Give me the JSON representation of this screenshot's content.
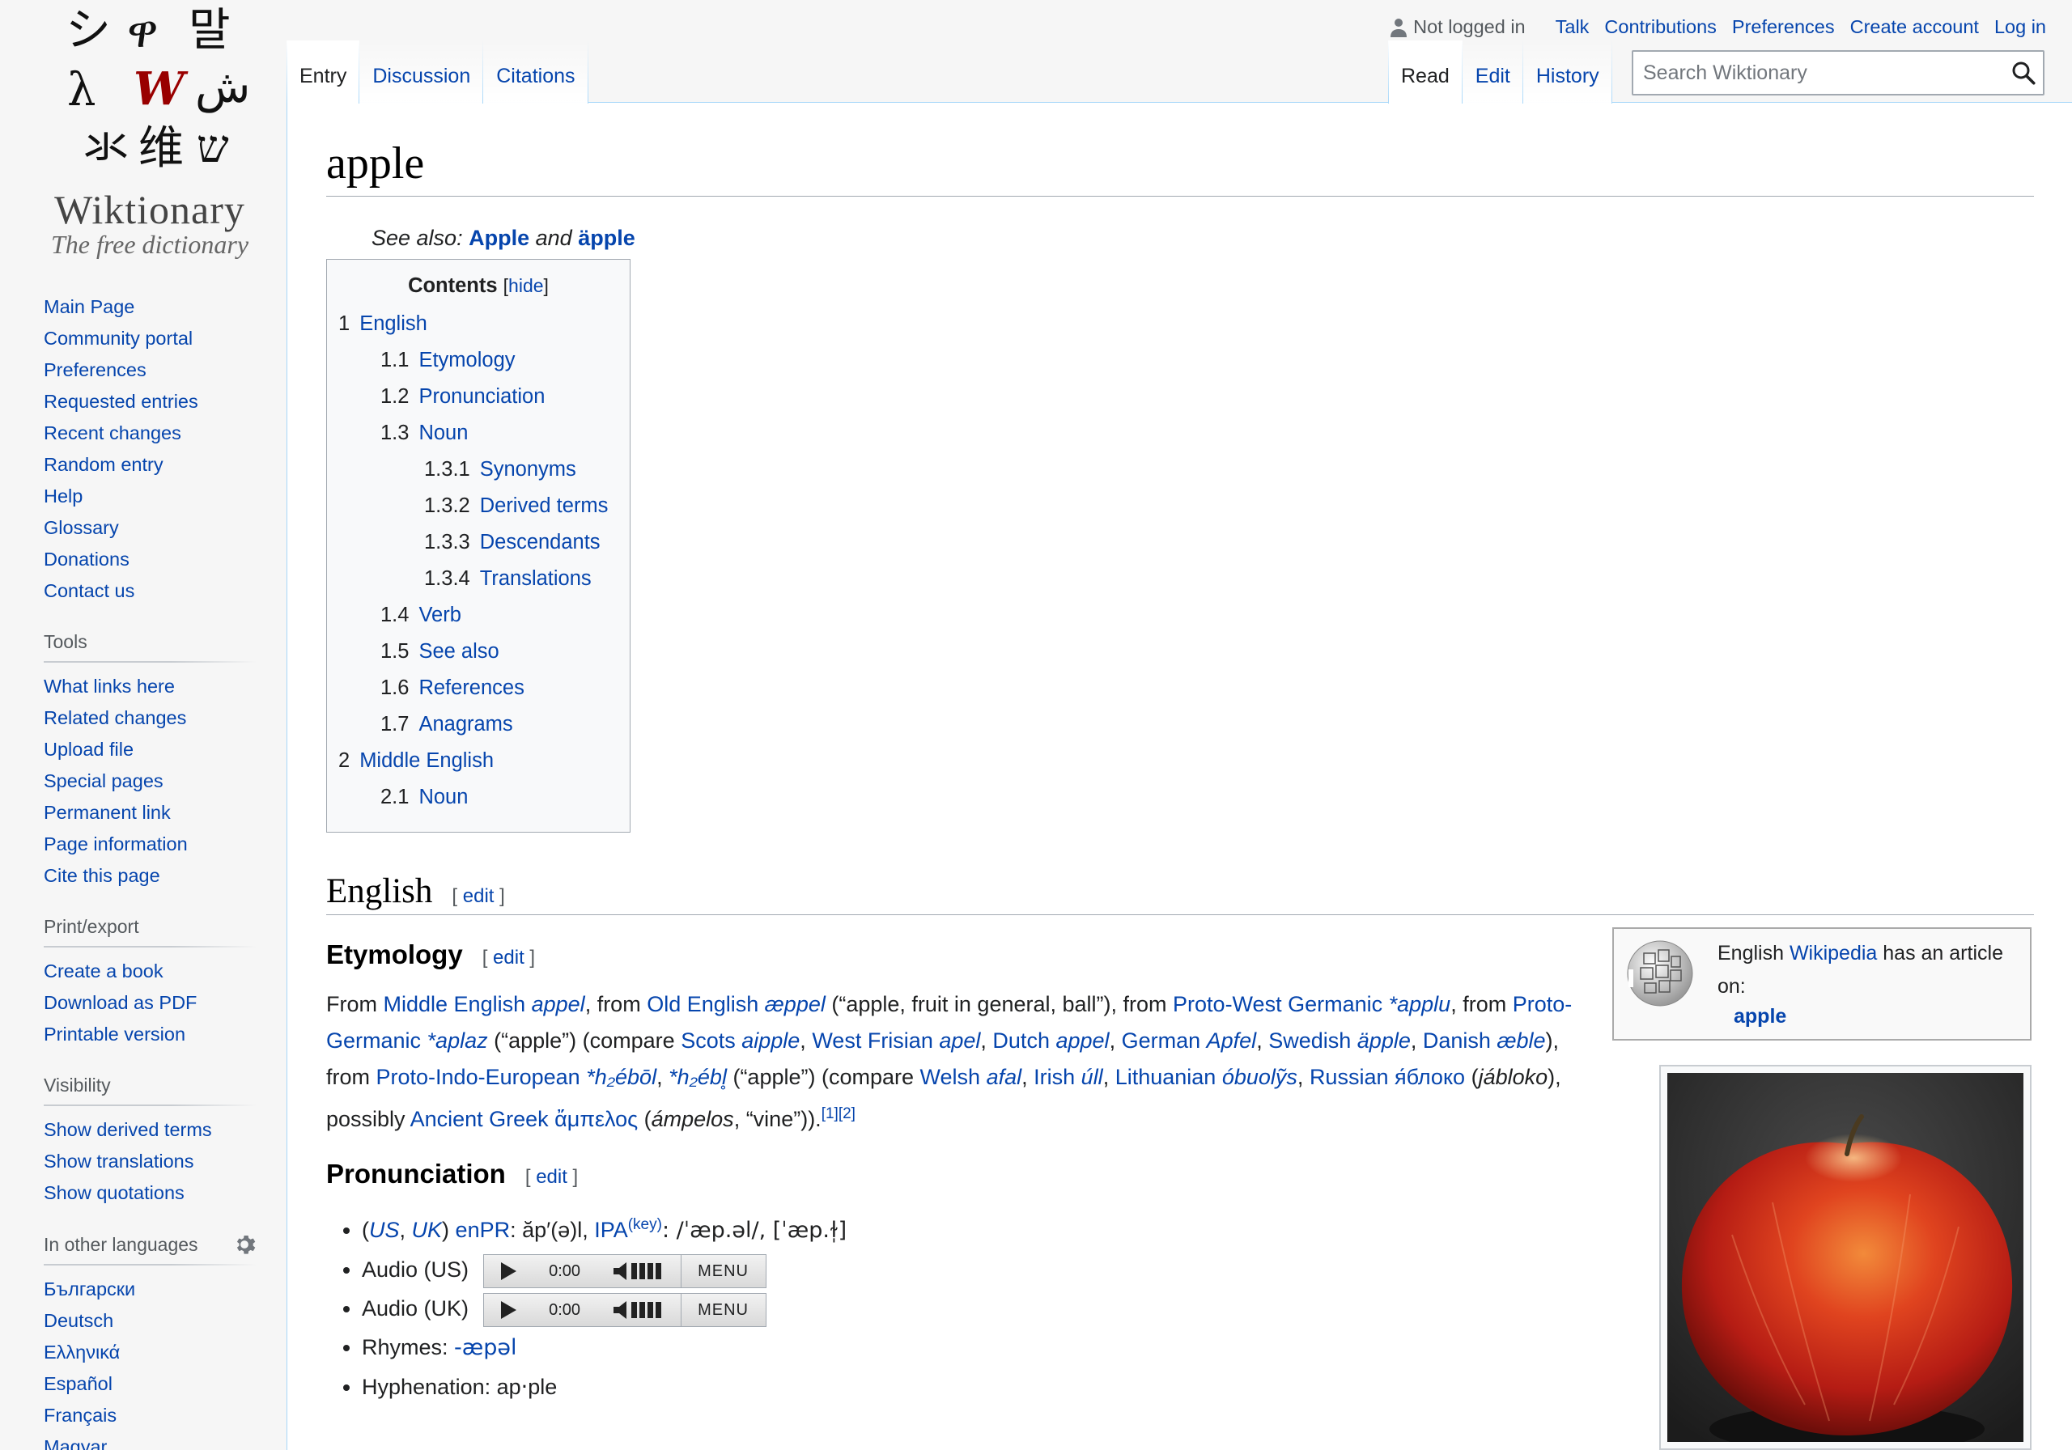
{
  "logo": {
    "glyphs": [
      "シ",
      "ዋ",
      "말",
      "λ",
      "W",
      "ش",
      "氺",
      "维",
      "ש"
    ],
    "wordmark": "Wiktionary",
    "tagline": "The free dictionary"
  },
  "personal": {
    "anon": "Not logged in",
    "links": [
      "Talk",
      "Contributions",
      "Preferences",
      "Create account",
      "Log in"
    ]
  },
  "tabs": {
    "left": [
      "Entry",
      "Discussion",
      "Citations"
    ],
    "right": [
      "Read",
      "Edit",
      "History"
    ],
    "selected_left": "Entry",
    "selected_right": "Read"
  },
  "search": {
    "placeholder": "Search Wiktionary"
  },
  "sidebar": {
    "navigation": [
      "Main Page",
      "Community portal",
      "Preferences",
      "Requested entries",
      "Recent changes",
      "Random entry",
      "Help",
      "Glossary",
      "Donations",
      "Contact us"
    ],
    "tools": {
      "title": "Tools",
      "items": [
        "What links here",
        "Related changes",
        "Upload file",
        "Special pages",
        "Permanent link",
        "Page information",
        "Cite this page"
      ]
    },
    "print": {
      "title": "Print/export",
      "items": [
        "Create a book",
        "Download as PDF",
        "Printable version"
      ]
    },
    "visibility": {
      "title": "Visibility",
      "items": [
        "Show derived terms",
        "Show translations",
        "Show quotations"
      ]
    },
    "languages": {
      "title": "In other languages",
      "items": [
        "Български",
        "Deutsch",
        "Ελληνικά",
        "Español",
        "Français",
        "Magyar"
      ]
    }
  },
  "page": {
    "title": "apple",
    "see_also": {
      "prefix": "See also:",
      "a": "Apple",
      "and": "and",
      "b": "äpple"
    },
    "toc": {
      "title": "Contents",
      "hide": "hide",
      "items": [
        {
          "num": "1",
          "label": "English",
          "level": 1
        },
        {
          "num": "1.1",
          "label": "Etymology",
          "level": 2
        },
        {
          "num": "1.2",
          "label": "Pronunciation",
          "level": 2
        },
        {
          "num": "1.3",
          "label": "Noun",
          "level": 2
        },
        {
          "num": "1.3.1",
          "label": "Synonyms",
          "level": 3
        },
        {
          "num": "1.3.2",
          "label": "Derived terms",
          "level": 3
        },
        {
          "num": "1.3.3",
          "label": "Descendants",
          "level": 3
        },
        {
          "num": "1.3.4",
          "label": "Translations",
          "level": 3
        },
        {
          "num": "1.4",
          "label": "Verb",
          "level": 2
        },
        {
          "num": "1.5",
          "label": "See also",
          "level": 2
        },
        {
          "num": "1.6",
          "label": "References",
          "level": 2
        },
        {
          "num": "1.7",
          "label": "Anagrams",
          "level": 2
        },
        {
          "num": "2",
          "label": "Middle English",
          "level": 1
        },
        {
          "num": "2.1",
          "label": "Noun",
          "level": 2
        }
      ]
    },
    "english_heading": "English",
    "edit_label": "edit",
    "etymology_heading": "Etymology",
    "etymology": [
      {
        "t": "From "
      },
      {
        "t": "Middle English",
        "link": true
      },
      {
        "t": " "
      },
      {
        "t": "appel",
        "link": true,
        "italic": true
      },
      {
        "t": ", from "
      },
      {
        "t": "Old English",
        "link": true
      },
      {
        "t": " "
      },
      {
        "t": "æppel",
        "link": true,
        "italic": true
      },
      {
        "t": " (“apple, fruit in general, ball”), from "
      },
      {
        "t": "Proto-West Germanic",
        "link": true
      },
      {
        "t": " "
      },
      {
        "t": "*applu",
        "link": true,
        "italic": true
      },
      {
        "t": ", from "
      },
      {
        "t": "Proto-Germanic",
        "link": true
      },
      {
        "t": " "
      },
      {
        "t": "*aplaz",
        "link": true,
        "italic": true
      },
      {
        "t": " (“apple”) (compare "
      },
      {
        "t": "Scots",
        "link": true
      },
      {
        "t": " "
      },
      {
        "t": "aipple",
        "link": true,
        "italic": true
      },
      {
        "t": ", "
      },
      {
        "t": "West Frisian",
        "link": true
      },
      {
        "t": " "
      },
      {
        "t": "apel",
        "link": true,
        "italic": true
      },
      {
        "t": ", "
      },
      {
        "t": "Dutch",
        "link": true
      },
      {
        "t": " "
      },
      {
        "t": "appel",
        "link": true,
        "italic": true
      },
      {
        "t": ", "
      },
      {
        "t": "German",
        "link": true
      },
      {
        "t": " "
      },
      {
        "t": "Apfel",
        "link": true,
        "italic": true
      },
      {
        "t": ", "
      },
      {
        "t": "Swedish",
        "link": true
      },
      {
        "t": " "
      },
      {
        "t": "äpple",
        "link": true,
        "italic": true
      },
      {
        "t": ", "
      },
      {
        "t": "Danish",
        "link": true
      },
      {
        "t": " "
      },
      {
        "t": "æble",
        "link": true,
        "italic": true
      },
      {
        "t": "), from "
      },
      {
        "t": "Proto-Indo-European",
        "link": true
      },
      {
        "t": " "
      },
      {
        "t": "*h₂ébōl",
        "link": true,
        "italic": true
      },
      {
        "t": ", "
      },
      {
        "t": "*h₂ébl̥",
        "link": true,
        "italic": true
      },
      {
        "t": " (“apple”) (compare "
      },
      {
        "t": "Welsh",
        "link": true
      },
      {
        "t": " "
      },
      {
        "t": "afal",
        "link": true,
        "italic": true
      },
      {
        "t": ", "
      },
      {
        "t": "Irish",
        "link": true
      },
      {
        "t": " "
      },
      {
        "t": "úll",
        "link": true,
        "italic": true
      },
      {
        "t": ", "
      },
      {
        "t": "Lithuanian",
        "link": true
      },
      {
        "t": " "
      },
      {
        "t": "óbuolỹs",
        "link": true,
        "italic": true
      },
      {
        "t": ", "
      },
      {
        "t": "Russian",
        "link": true
      },
      {
        "t": " "
      },
      {
        "t": "я́блоко",
        "link": true
      },
      {
        "t": " ("
      },
      {
        "t": "jábloko",
        "italic": true
      },
      {
        "t": "), possibly "
      },
      {
        "t": "Ancient Greek",
        "link": true
      },
      {
        "t": " "
      },
      {
        "t": "ἄμπελος",
        "link": true
      },
      {
        "t": " ("
      },
      {
        "t": "ámpelos",
        "italic": true
      },
      {
        "t": ", “vine”))."
      },
      {
        "t": "[1]",
        "link": true,
        "sup": true
      },
      {
        "t": "[2]",
        "link": true,
        "sup": true
      }
    ],
    "pronunciation_heading": "Pronunciation",
    "pron": {
      "us": "US",
      "uk": "UK",
      "enpr_label": "enPR",
      "enpr": ": ăp′(ə)l, ",
      "ipa_label": "IPA",
      "key": "(key)",
      "ipa": ": /ˈæp.əl/, [ˈæp.ɫ̩]",
      "audio_us": "Audio (US)",
      "audio_uk": "Audio (UK)",
      "time": "0:00",
      "menu": "MENU",
      "rhymes_label": "Rhymes: ",
      "rhymes": "-æpəl",
      "hyphenation": "Hyphenation: ap‧ple"
    },
    "wikipedia_box": {
      "prefix": "English ",
      "link": "Wikipedia",
      "suffix": " has an article on:",
      "article": "apple"
    }
  },
  "colors": {
    "link": "#0645ad",
    "tab_border": "#a7d7f9",
    "apple_red": "#c8281c"
  }
}
